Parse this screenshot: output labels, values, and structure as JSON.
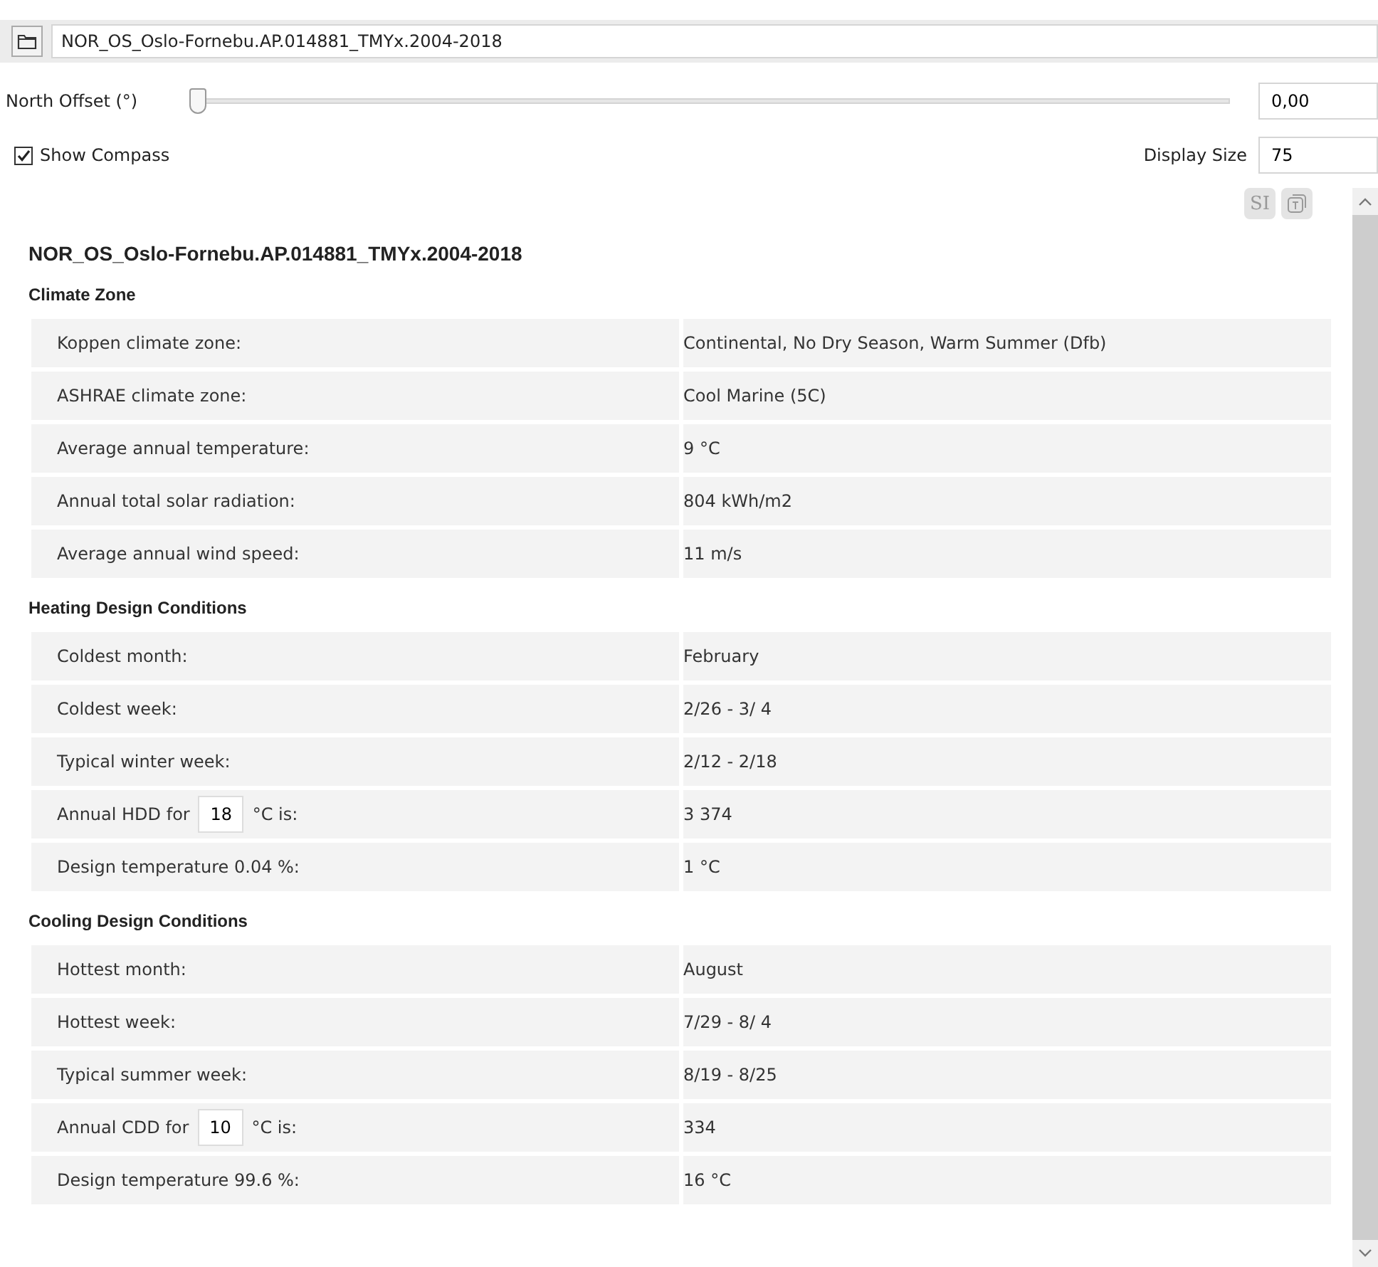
{
  "file": {
    "path": "NOR_OS_Oslo-Fornebu.AP.014881_TMYx.2004-2018"
  },
  "north_offset": {
    "label": "North Offset (°)",
    "level": 0,
    "value": "0,00"
  },
  "show_compass": {
    "label": "Show Compass",
    "checked": true
  },
  "display_size": {
    "label": "Display Size",
    "value": "75"
  },
  "unit_buttons": [
    {
      "label": "SI",
      "kind": "text"
    },
    {
      "kind": "icon"
    }
  ],
  "report": {
    "title": "NOR_OS_Oslo-Fornebu.AP.014881_TMYx.2004-2018",
    "sections": [
      {
        "heading": "Climate Zone",
        "rows": [
          {
            "kind": "text",
            "label": "Koppen climate zone:",
            "value": "Continental, No Dry Season, Warm Summer (Dfb)"
          },
          {
            "kind": "text",
            "label": "ASHRAE climate zone:",
            "value": "Cool Marine (5C)"
          },
          {
            "kind": "text",
            "label": "Average annual temperature:",
            "value": "9 °C"
          },
          {
            "kind": "text",
            "label": "Annual total solar radiation:",
            "value": "804 kWh/m2"
          },
          {
            "kind": "text",
            "label": "Average annual wind speed:",
            "value": "11 m/s"
          }
        ]
      },
      {
        "heading": "Heating Design Conditions",
        "rows": [
          {
            "kind": "text",
            "label": "Coldest month:",
            "value": "February"
          },
          {
            "kind": "text",
            "label": "Coldest week:",
            "value": "2/26 - 3/ 4"
          },
          {
            "kind": "text",
            "label": "Typical winter week:",
            "value": "2/12 - 2/18"
          },
          {
            "kind": "input",
            "label": "Annual HDD for",
            "input": "18",
            "suffix": "°C is:",
            "value": "3 374"
          },
          {
            "kind": "text",
            "label": "Design temperature 0.04 %:",
            "value": "1 °C"
          }
        ]
      },
      {
        "heading": "Cooling Design Conditions",
        "rows": [
          {
            "kind": "text",
            "label": "Hottest month:",
            "value": "August"
          },
          {
            "kind": "text",
            "label": "Hottest week:",
            "value": "7/29 - 8/ 4"
          },
          {
            "kind": "text",
            "label": "Typical summer week:",
            "value": "8/19 - 8/25"
          },
          {
            "kind": "input",
            "label": "Annual CDD for",
            "input": "10",
            "suffix": "°C is:",
            "value": "334"
          },
          {
            "kind": "text",
            "label": "Design temperature 99.6 %:",
            "value": "16 °C"
          }
        ]
      }
    ]
  }
}
